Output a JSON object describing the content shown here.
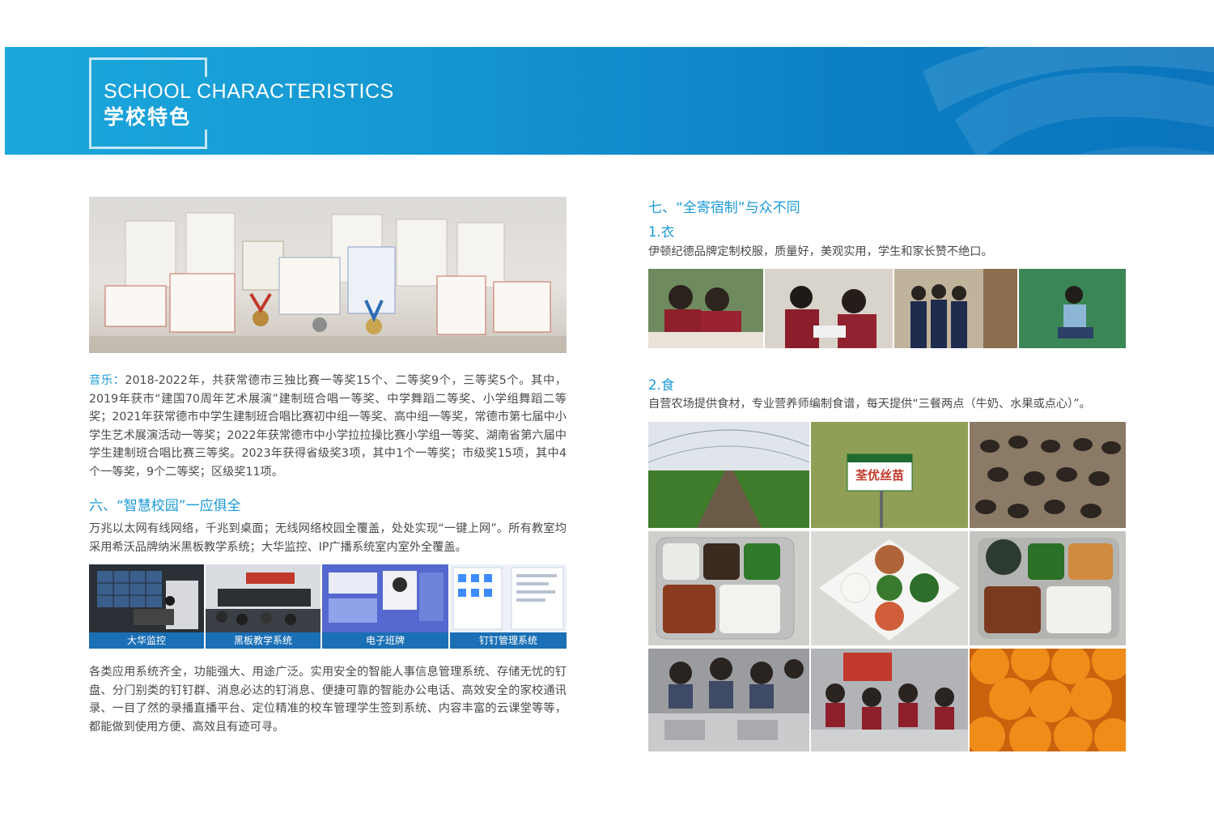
{
  "header": {
    "title_en": "SCHOOL  CHARACTERISTICS",
    "title_zh": "学校特色"
  },
  "music": {
    "label": "音乐：",
    "text": "2018-2022年，共获常德市三独比赛一等奖15个、二等奖9个，三等奖5个。其中，2019年获市“建国70周年艺术展演”建制班合唱一等奖、中学舞蹈二等奖、小学组舞蹈二等奖；2021年获常德市中学生建制班合唱比赛初中组一等奖、高中组一等奖，常德市第七届中小学生艺术展演活动一等奖；2022年获常德市中小学拉拉操比赛小学组一等奖、湖南省第六届中学生建制班合唱比赛三等奖。2023年获得省级奖3项，其中1个一等奖；市级奖15项，其中4个一等奖，9个二等奖；区级奖11项。"
  },
  "smart_campus": {
    "heading": "六、“智慧校园”一应俱全",
    "intro": "万兆以太网有线网络，千兆到桌面；无线网络校园全覆盖，处处实现“一键上网”。所有教室均采用希沃品牌纳米黑板教学系统；大华监控、IP广播系统室内室外全覆盖。",
    "captions": [
      "大华监控",
      "黑板教学系统",
      "电子班牌",
      "钉钉管理系统"
    ],
    "outro": "各类应用系统齐全，功能强大、用途广泛。实用安全的智能人事信息管理系统、存储无忧的钉盘、分门别类的钉钉群、消息必达的钉消息、便捷可靠的智能办公电话、高效安全的家校通讯录、一目了然的录播直播平台、定位精准的校车管理学生签到系统、内容丰富的云课堂等等，都能做到使用方便、高效且有迹可寻。"
  },
  "boarding": {
    "heading": "七、“全寄宿制”与众不同",
    "clothing": {
      "title": "1.衣",
      "text": "伊顿纪德品牌定制校服，质量好，美观实用，学生和家长赞不绝口。"
    },
    "food": {
      "title": "2.食",
      "text": "自营农场提供食材，专业营养师编制食谱，每天提供“三餐两点（牛奶、水果或点心）”。",
      "sign_text": "荃优丝苗"
    }
  },
  "colors": {
    "accent": "#1b9ad6",
    "banner": "#1597d2",
    "caption_bar": "#1a6fb5"
  }
}
